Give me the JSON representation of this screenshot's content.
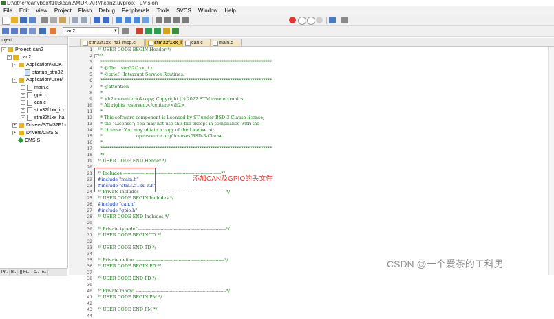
{
  "title_bar": {
    "path": "D:\\other\\canvbox\\f103\\can2\\MDK-ARM\\can2.uvprojx - µVision"
  },
  "menu": [
    "File",
    "Edit",
    "View",
    "Project",
    "Flash",
    "Debug",
    "Peripherals",
    "Tools",
    "SVCS",
    "Window",
    "Help"
  ],
  "toolbar": {
    "target_name": "can2"
  },
  "project_panel": {
    "header": "roject",
    "tree": [
      {
        "label": "Project: can2",
        "kind": "root"
      },
      {
        "label": "can2",
        "kind": "folder"
      },
      {
        "label": "Application/MDK",
        "kind": "folder"
      },
      {
        "label": "startup_stm32",
        "kind": "file-s"
      },
      {
        "label": "Application/User/",
        "kind": "folder"
      },
      {
        "label": "main.c",
        "kind": "file-c"
      },
      {
        "label": "gpio.c",
        "kind": "file-c"
      },
      {
        "label": "can.c",
        "kind": "file-c"
      },
      {
        "label": "stm32f1xx_it.c",
        "kind": "file-c"
      },
      {
        "label": "stm32f1xx_ha",
        "kind": "file-c"
      },
      {
        "label": "Drivers/STM32F1x",
        "kind": "folder"
      },
      {
        "label": "Drivers/CMSIS",
        "kind": "folder"
      },
      {
        "label": "CMSIS",
        "kind": "diamond"
      }
    ],
    "bottom_tabs": [
      "Pr..",
      "B..",
      "{} Fu..",
      "0.. Te.."
    ]
  },
  "tabs": [
    {
      "label": "stm32f1xx_hal_msp.c",
      "active": false
    },
    {
      "label": "stm32f1xx_it.c",
      "active": true
    },
    {
      "label": "can.c",
      "active": false
    },
    {
      "label": "main.c",
      "active": false
    }
  ],
  "code_lines": [
    {
      "n": "1",
      "t": "/* USER CODE BEGIN Header */",
      "k": "c"
    },
    {
      "n": "2",
      "t": "/**",
      "k": "c"
    },
    {
      "n": "3",
      "t": "  ******************************************************************************",
      "k": "c"
    },
    {
      "n": "4",
      "t": "  * @file    stm32f1xx_it.c",
      "k": "c"
    },
    {
      "n": "5",
      "t": "  * @brief   Interrupt Service Routines.",
      "k": "c"
    },
    {
      "n": "6",
      "t": "  ******************************************************************************",
      "k": "c"
    },
    {
      "n": "7",
      "t": "  * @attention",
      "k": "c"
    },
    {
      "n": "8",
      "t": "  *",
      "k": "c"
    },
    {
      "n": "9",
      "t": "  * <h2><center>&copy; Copyright (c) 2022 STMicroelectronics.",
      "k": "c"
    },
    {
      "n": "10",
      "t": "  * All rights reserved.</center></h2>",
      "k": "c"
    },
    {
      "n": "11",
      "t": "  *",
      "k": "c"
    },
    {
      "n": "12",
      "t": "  * This software component is licensed by ST under BSD 3-Clause license,",
      "k": "c"
    },
    {
      "n": "13",
      "t": "  * the \"License\"; You may not use this file except in compliance with the",
      "k": "c"
    },
    {
      "n": "14",
      "t": "  * License. You may obtain a copy of the License at:",
      "k": "c"
    },
    {
      "n": "15",
      "t": "  *                        opensource.org/licenses/BSD-3-Clause",
      "k": "c"
    },
    {
      "n": "16",
      "t": "  *",
      "k": "c"
    },
    {
      "n": "17",
      "t": "  ******************************************************************************",
      "k": "c"
    },
    {
      "n": "18",
      "t": "  */",
      "k": "c"
    },
    {
      "n": "19",
      "t": "/* USER CODE END Header */",
      "k": "c"
    },
    {
      "n": "20",
      "t": "",
      "k": "c"
    },
    {
      "n": "21",
      "t": "/* Includes ------------------------------------------------------------------*/",
      "k": "c"
    },
    {
      "n": "22",
      "t": "#include \"main.h\"",
      "k": "p"
    },
    {
      "n": "23",
      "t": "#include \"stm32f1xx_it.h\"",
      "k": "p"
    },
    {
      "n": "24",
      "t": "/* Private includes ----------------------------------------------------------*/",
      "k": "c"
    },
    {
      "n": "25",
      "t": "/* USER CODE BEGIN Includes */",
      "k": "c"
    },
    {
      "n": "26",
      "t": "#include \"can.h\"",
      "k": "p"
    },
    {
      "n": "27",
      "t": "#include \"gpio.h\"",
      "k": "p"
    },
    {
      "n": "28",
      "t": "/* USER CODE END Includes */",
      "k": "c"
    },
    {
      "n": "29",
      "t": "",
      "k": "c"
    },
    {
      "n": "30",
      "t": "/* Private typedef -----------------------------------------------------------*/",
      "k": "c"
    },
    {
      "n": "31",
      "t": "/* USER CODE BEGIN TD */",
      "k": "c"
    },
    {
      "n": "32",
      "t": "",
      "k": "c"
    },
    {
      "n": "33",
      "t": "/* USER CODE END TD */",
      "k": "c"
    },
    {
      "n": "34",
      "t": "",
      "k": "c"
    },
    {
      "n": "35",
      "t": "/* Private define ------------------------------------------------------------*/",
      "k": "c"
    },
    {
      "n": "36",
      "t": "/* USER CODE BEGIN PD */",
      "k": "c"
    },
    {
      "n": "37",
      "t": "",
      "k": "c"
    },
    {
      "n": "38",
      "t": "/* USER CODE END PD */",
      "k": "c"
    },
    {
      "n": "39",
      "t": "",
      "k": "c"
    },
    {
      "n": "40",
      "t": "/* Private macro -------------------------------------------------------------*/",
      "k": "c"
    },
    {
      "n": "41",
      "t": "/* USER CODE BEGIN PM */",
      "k": "c"
    },
    {
      "n": "42",
      "t": "",
      "k": "c"
    },
    {
      "n": "43",
      "t": "/* USER CODE END PM */",
      "k": "c"
    },
    {
      "n": "44",
      "t": "",
      "k": "c"
    }
  ],
  "annotation": {
    "text": "添加CAN及GPIO的头文件",
    "color": "#e53935"
  },
  "watermark": "CSDN @一个爱茶的工科男"
}
